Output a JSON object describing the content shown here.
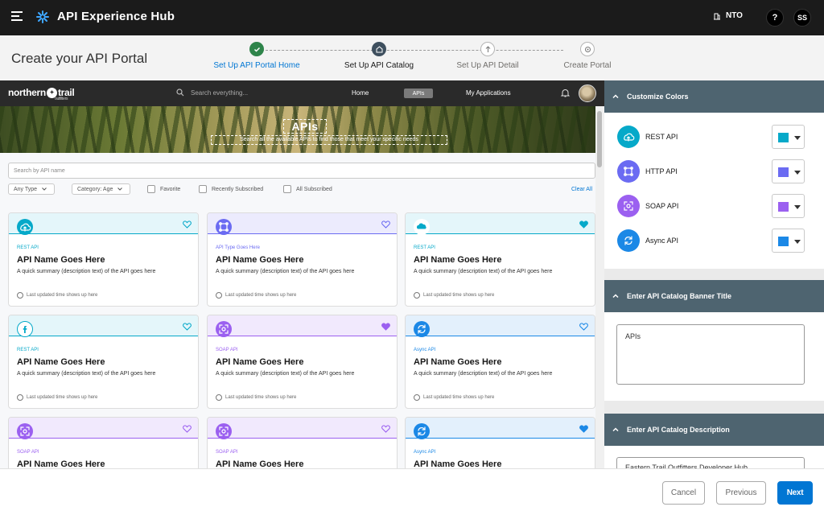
{
  "app": {
    "title": "API Experience Hub",
    "org": "NTO",
    "help": "?",
    "user_initials": "SS"
  },
  "page": {
    "title": "Create your API Portal"
  },
  "stepper": [
    {
      "label": "Set Up API Portal Home",
      "state": "done"
    },
    {
      "label": "Set Up API Catalog",
      "state": "current"
    },
    {
      "label": "Set Up API Detail",
      "state": "todo"
    },
    {
      "label": "Create Portal",
      "state": "todo"
    }
  ],
  "preview": {
    "brand": "northern",
    "brand_b": "trail",
    "brand_sub": "outfitters",
    "search_placeholder": "Search everything...",
    "nav": {
      "home": "Home",
      "apis": "APIs",
      "apps": "My Applications"
    },
    "banner_title": "APIs",
    "banner_desc": "Search all the available APIs to find those that meet your specific needs",
    "api_search_placeholder": "Search by API name",
    "filters": {
      "type": "Any Type",
      "category": "Category: Age",
      "favorite": "Favorite",
      "recent": "Recently Subscribed",
      "all": "All Subscribed",
      "clear": "Clear All"
    }
  },
  "cards": [
    {
      "type": "REST API",
      "name": "API Name Goes Here",
      "desc": "A quick summary (description text) of the API goes here",
      "time": "Last updated time shows up here",
      "kind": "rest",
      "fav": false,
      "icon": "rest-api-icon"
    },
    {
      "type": "API Type Goes Here",
      "name": "API Name Goes Here",
      "desc": "A quick summary (description text) of the API goes here",
      "time": "Last updated time shows up here",
      "kind": "http",
      "fav": false,
      "icon": "http-api-icon"
    },
    {
      "type": "REST API",
      "name": "API Name Goes Here",
      "desc": "A quick summary (description text) of the API goes here",
      "time": "Last updated time shows up here",
      "kind": "rest",
      "fav": true,
      "icon": "salesforce-cloud-icon"
    },
    {
      "type": "REST API",
      "name": "API Name Goes Here",
      "desc": "A quick summary (description text) of the API goes here",
      "time": "Last updated time shows up here",
      "kind": "rest",
      "fav": false,
      "icon": "facebook-icon"
    },
    {
      "type": "SOAP API",
      "name": "API Name Goes Here",
      "desc": "A quick summary (description text) of the API goes here",
      "time": "Last updated time shows up here",
      "kind": "soap",
      "fav": true,
      "icon": "soap-api-icon"
    },
    {
      "type": "Async API",
      "name": "API Name Goes Here",
      "desc": "A quick summary (description text) of the API goes here",
      "time": "Last updated time shows up here",
      "kind": "async",
      "fav": false,
      "icon": "async-api-icon"
    },
    {
      "type": "SOAP API",
      "name": "API Name Goes Here",
      "desc": "",
      "time": "",
      "kind": "soap",
      "fav": false,
      "icon": "soap-api-icon"
    },
    {
      "type": "SOAP API",
      "name": "API Name Goes Here",
      "desc": "",
      "time": "",
      "kind": "soap",
      "fav": false,
      "icon": "soap-api-icon"
    },
    {
      "type": "Async API",
      "name": "API Name Goes Here",
      "desc": "",
      "time": "",
      "kind": "async",
      "fav": true,
      "icon": "async-api-icon"
    }
  ],
  "colors": {
    "rest": "#06a9c9",
    "http": "#6b6bf2",
    "soap": "#9b60f0",
    "async": "#1b88e6",
    "rest_tint": "#e4f6fa",
    "http_tint": "#ecebfd",
    "soap_tint": "#f1e9fd",
    "async_tint": "#e3f0fc"
  },
  "customize": {
    "heading": "Customize Colors",
    "rows": [
      {
        "name": "REST API",
        "kind": "rest"
      },
      {
        "name": "HTTP API",
        "kind": "http"
      },
      {
        "name": "SOAP API",
        "kind": "soap"
      },
      {
        "name": "Async API",
        "kind": "async"
      }
    ]
  },
  "banner_title_section": {
    "heading": "Enter API Catalog Banner Title",
    "value": "APIs"
  },
  "description_section": {
    "heading": "Enter API Catalog Description",
    "value": "Eastern Trail Outfitters Developer Hub"
  },
  "footer": {
    "cancel": "Cancel",
    "previous": "Previous",
    "next": "Next"
  }
}
